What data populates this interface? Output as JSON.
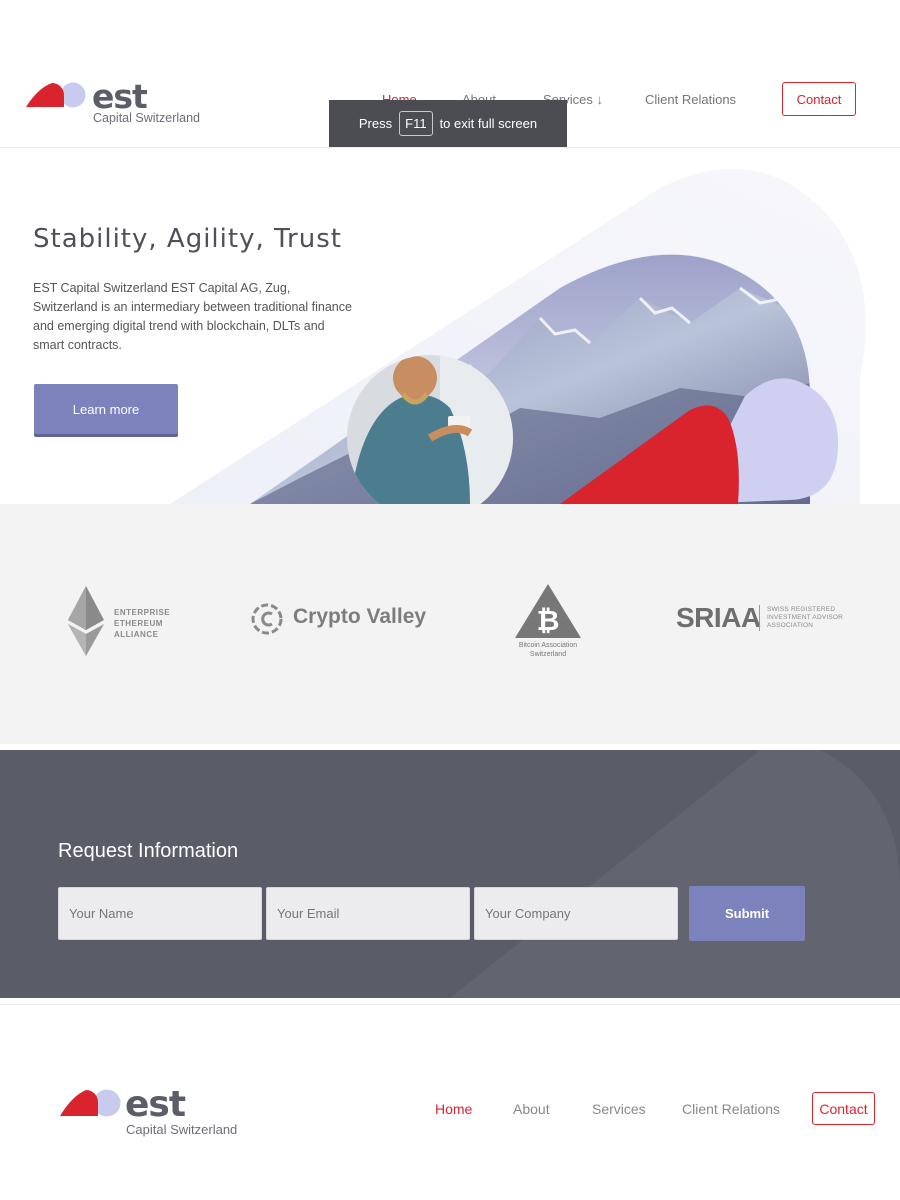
{
  "header": {
    "logo": {
      "word": "est",
      "sub": "Capital Switzerland"
    },
    "nav": {
      "home": "Home",
      "about": "About",
      "services": "Services ↓",
      "client_relations": "Client Relations"
    },
    "contact": "Contact"
  },
  "fullscreen_toast": {
    "before": "Press",
    "key": "F11",
    "after": "to exit full screen"
  },
  "hero": {
    "title": "Stability, Agility, Trust",
    "text": "EST Capital Switzerland EST Capital AG, Zug, Switzerland is an intermediary between traditional finance and emerging digital trend with blockchain, DLTs and smart contracts.",
    "button": "Learn more"
  },
  "partners": {
    "eea": [
      "ENTERPRISE",
      "ETHEREUM",
      "ALLIANCE"
    ],
    "crypto_valley": "Crypto Valley",
    "bitcoin_assoc": [
      "Bitcoin Association",
      "Switzerland"
    ],
    "sriaa": {
      "name": "SRIAA",
      "desc": [
        "SWISS REGISTERED",
        "INVESTMENT ADVISOR",
        "ASSOCIATION"
      ]
    }
  },
  "request": {
    "title": "Request Information",
    "name_placeholder": "Your Name",
    "email_placeholder": "Your Email",
    "company_placeholder": "Your Company",
    "submit": "Submit"
  },
  "footer": {
    "logo": {
      "word": "est",
      "sub": "Capital Switzerland"
    },
    "nav": {
      "home": "Home",
      "about": "About",
      "services": "Services",
      "client_relations": "Client Relations"
    },
    "contact": "Contact"
  },
  "colors": {
    "brand_red": "#d9232d",
    "brand_lavender": "#c9cbee",
    "accent_button": "#7c82bc",
    "dark_band": "#5a5c68"
  },
  "icons": [
    "est-logo-icon",
    "ethereum-icon",
    "crypto-valley-icon",
    "bitcoin-icon"
  ]
}
